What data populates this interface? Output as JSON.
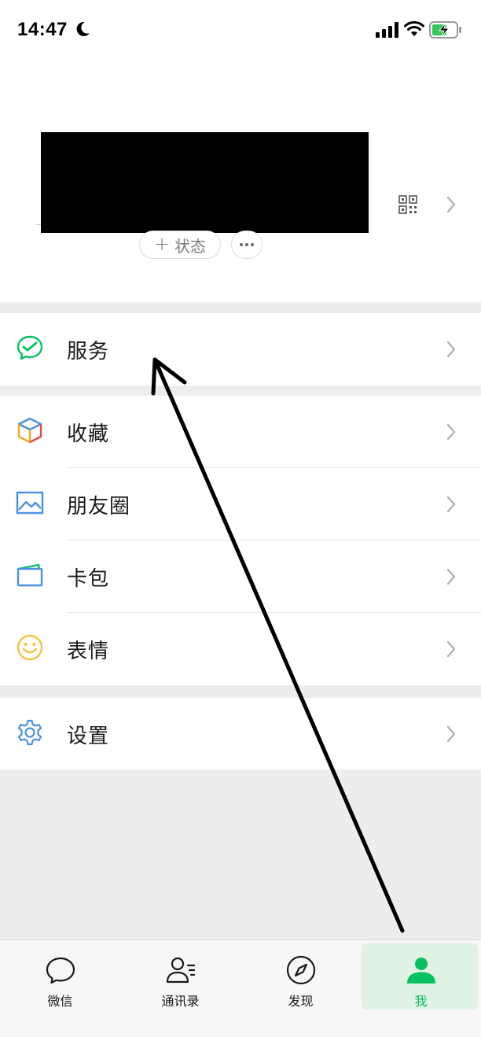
{
  "status_bar": {
    "time": "14:47"
  },
  "profile": {
    "status_button_label": "状态",
    "plus_symbol": "+"
  },
  "menu": {
    "service": {
      "label": "服务",
      "icon": "service-check-icon"
    },
    "favorites": {
      "label": "收藏",
      "icon": "cube-icon"
    },
    "moments": {
      "label": "朋友圈",
      "icon": "image-icon"
    },
    "cards": {
      "label": "卡包",
      "icon": "card-icon"
    },
    "stickers": {
      "label": "表情",
      "icon": "smiley-icon"
    },
    "settings": {
      "label": "设置",
      "icon": "gear-icon"
    }
  },
  "tabbar": {
    "tabs": [
      {
        "label": "微信",
        "icon": "chat-bubble-icon",
        "active": false
      },
      {
        "label": "通讯录",
        "icon": "contacts-icon",
        "active": false
      },
      {
        "label": "发现",
        "icon": "compass-icon",
        "active": false
      },
      {
        "label": "我",
        "icon": "person-icon",
        "active": true
      }
    ]
  },
  "colors": {
    "accent_green": "#07c160",
    "background_gray": "#ededed",
    "redaction": "#000000"
  }
}
